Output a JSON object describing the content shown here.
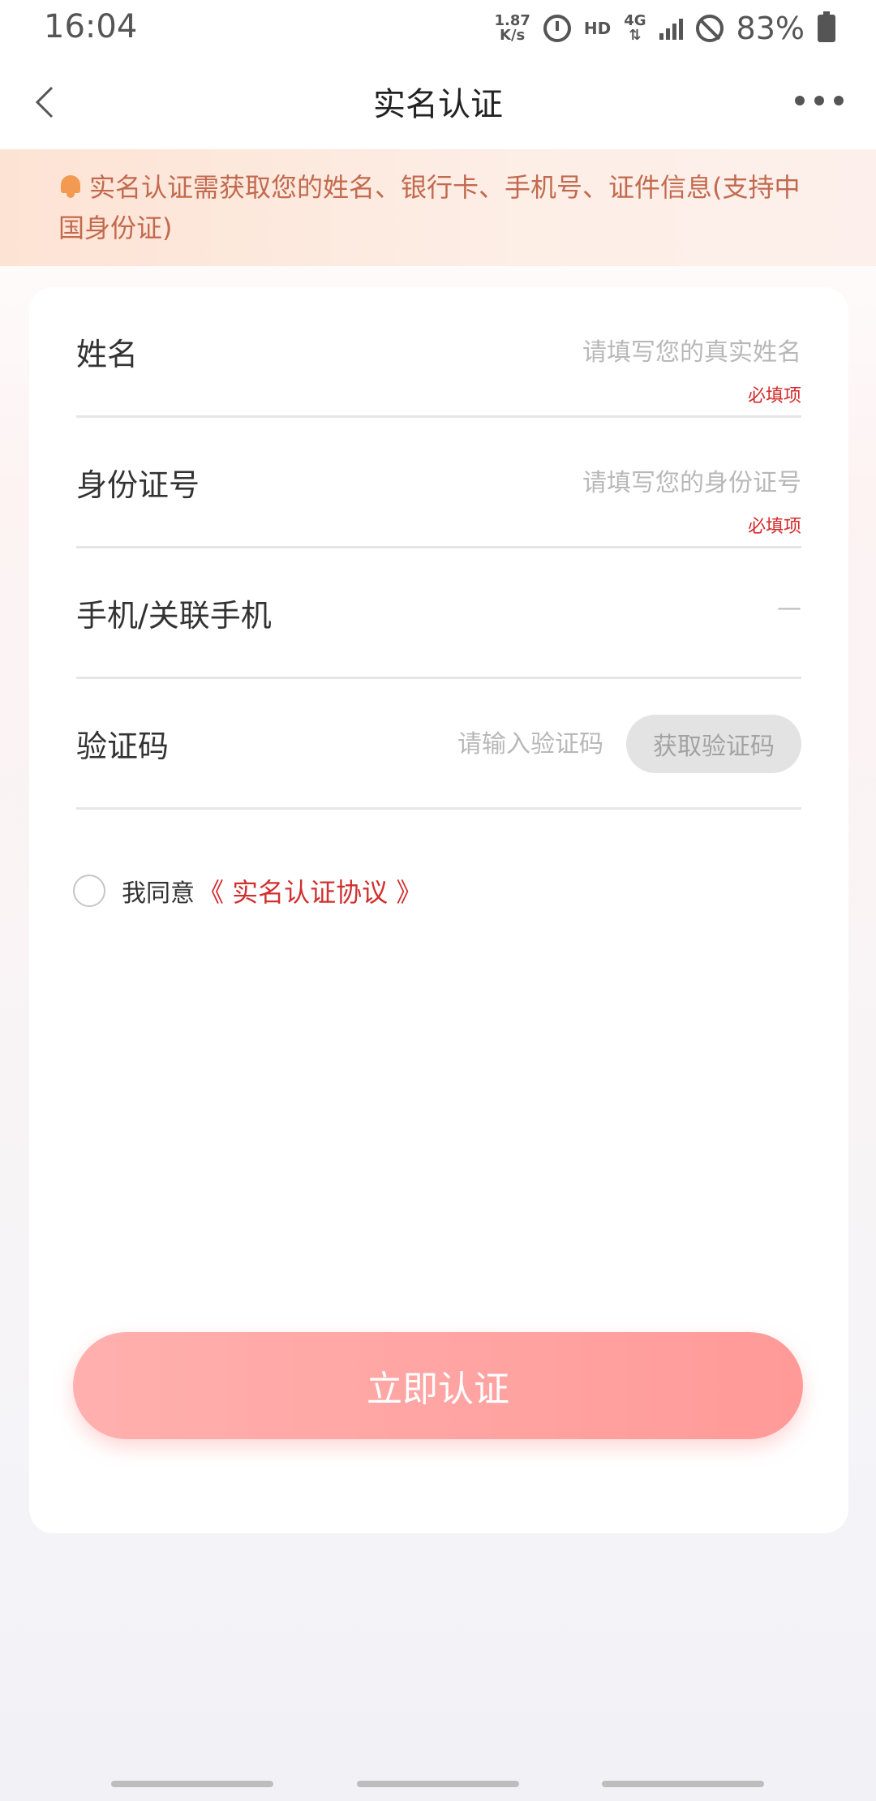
{
  "status_bar": {
    "time": "16:04",
    "net_speed_value": "1.87",
    "net_speed_unit": "K/s",
    "hd": "HD",
    "network": "4G",
    "battery": "83%"
  },
  "nav": {
    "title": "实名认证"
  },
  "notice": {
    "icon": "bell-icon",
    "text": "实名认证需获取您的姓名、银行卡、手机号、证件信息(支持中国身份证)"
  },
  "form": {
    "name": {
      "label": "姓名",
      "placeholder": "请填写您的真实姓名",
      "required": "必填项"
    },
    "id_number": {
      "label": "身份证号",
      "placeholder": "请填写您的身份证号",
      "required": "必填项"
    },
    "phone": {
      "label": "手机/关联手机",
      "value": "—"
    },
    "code": {
      "label": "验证码",
      "placeholder": "请输入验证码",
      "button": "获取验证码"
    }
  },
  "agreement": {
    "prefix": "我同意",
    "link": "《 实名认证协议 》",
    "checked": false
  },
  "submit": {
    "label": "立即认证"
  },
  "colors": {
    "accent_red": "#d03030",
    "button_pink": "#ff9a98",
    "notice_text": "#c26a4f"
  }
}
